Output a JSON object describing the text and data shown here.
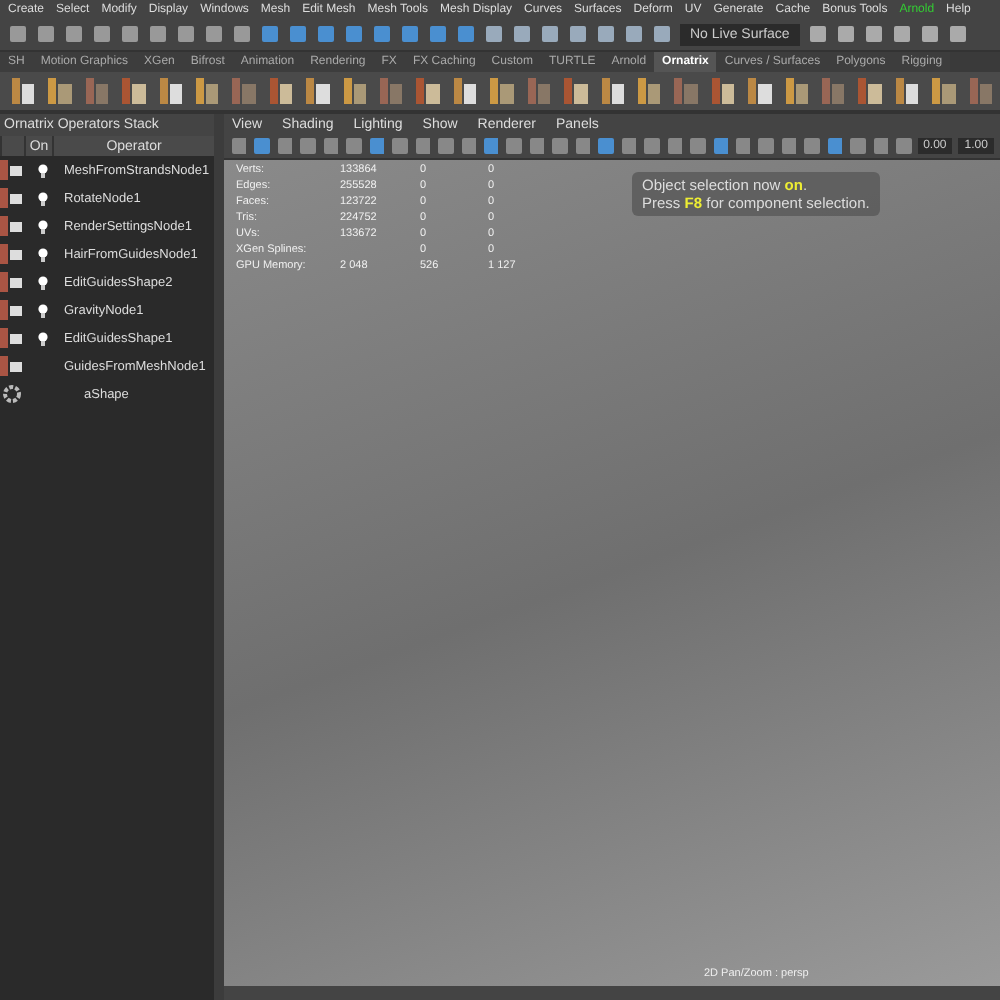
{
  "menu_bar": [
    "Create",
    "Select",
    "Modify",
    "Display",
    "Windows",
    "Mesh",
    "Edit Mesh",
    "Mesh Tools",
    "Mesh Display",
    "Curves",
    "Surfaces",
    "Deform",
    "UV",
    "Generate",
    "Cache",
    "Bonus Tools",
    "Arnold",
    "Help"
  ],
  "status_line": {
    "live_surface": "No Live Surface"
  },
  "shelf_tabs": [
    {
      "label": "SH",
      "selected": false
    },
    {
      "label": "Motion Graphics",
      "selected": false
    },
    {
      "label": "XGen",
      "selected": false
    },
    {
      "label": "Bifrost",
      "selected": false
    },
    {
      "label": "Animation",
      "selected": false
    },
    {
      "label": "Rendering",
      "selected": false
    },
    {
      "label": "FX",
      "selected": false
    },
    {
      "label": "FX Caching",
      "selected": false
    },
    {
      "label": "Custom",
      "selected": false
    },
    {
      "label": "TURTLE",
      "selected": false
    },
    {
      "label": "Arnold",
      "selected": false
    },
    {
      "label": "Ornatrix",
      "selected": true
    },
    {
      "label": "Curves / Surfaces",
      "selected": false
    },
    {
      "label": "Polygons",
      "selected": false
    },
    {
      "label": "Rigging",
      "selected": false
    }
  ],
  "operators_panel": {
    "title": "Ornatrix Operators Stack",
    "columns": [
      "On",
      "Operator"
    ],
    "rows": [
      {
        "name": "MeshFromStrandsNode1",
        "on": true,
        "kind": "node"
      },
      {
        "name": "RotateNode1",
        "on": true,
        "kind": "node"
      },
      {
        "name": "RenderSettingsNode1",
        "on": true,
        "kind": "node"
      },
      {
        "name": "HairFromGuidesNode1",
        "on": true,
        "kind": "node"
      },
      {
        "name": "EditGuidesShape2",
        "on": true,
        "kind": "node"
      },
      {
        "name": "GravityNode1",
        "on": true,
        "kind": "node"
      },
      {
        "name": "EditGuidesShape1",
        "on": true,
        "kind": "node"
      },
      {
        "name": "GuidesFromMeshNode1",
        "on": false,
        "kind": "node"
      },
      {
        "name": "aShape",
        "on": false,
        "kind": "shape"
      }
    ]
  },
  "viewport": {
    "menu": [
      "View",
      "Shading",
      "Lighting",
      "Show",
      "Renderer",
      "Panels"
    ],
    "fields": [
      "0.00",
      "1.00"
    ],
    "stats": [
      {
        "label": "Verts:",
        "values": [
          "133864",
          "0",
          "0"
        ]
      },
      {
        "label": "Edges:",
        "values": [
          "255528",
          "0",
          "0"
        ]
      },
      {
        "label": "Faces:",
        "values": [
          "123722",
          "0",
          "0"
        ]
      },
      {
        "label": "Tris:",
        "values": [
          "224752",
          "0",
          "0"
        ]
      },
      {
        "label": "UVs:",
        "values": [
          "133672",
          "0",
          "0"
        ]
      },
      {
        "label": "XGen Splines:",
        "values": [
          "0",
          "0"
        ]
      },
      {
        "label": "GPU Memory:",
        "values": [
          "2 048",
          "526",
          "1 127"
        ]
      }
    ],
    "message": [
      "Object selection now **on**.",
      "Press **F8** for component selection."
    ],
    "camera_label": "2D Pan/Zoom : persp"
  }
}
